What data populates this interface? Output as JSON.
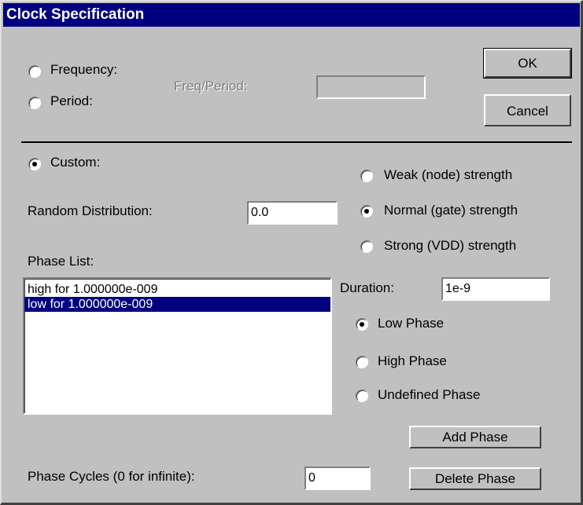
{
  "dialog": {
    "title": "Clock Specification"
  },
  "mode": {
    "frequency_label": "Frequency:",
    "period_label": "Period:",
    "custom_label": "Custom:",
    "selected": "Custom"
  },
  "freq_period": {
    "label": "Freq/Period:",
    "value": ""
  },
  "buttons": {
    "ok": "OK",
    "cancel": "Cancel",
    "add_phase": "Add Phase",
    "delete_phase": "Delete Phase"
  },
  "random_distribution": {
    "label": "Random Distribution:",
    "value": "0.0"
  },
  "strength": {
    "weak": "Weak (node) strength",
    "normal": "Normal (gate) strength",
    "strong": "Strong (VDD) strength",
    "selected": "Normal (gate) strength"
  },
  "phase_list": {
    "label": "Phase List:",
    "items": [
      "high for 1.000000e-009",
      "low for 1.000000e-009"
    ],
    "selected_index": 1
  },
  "duration": {
    "label": "Duration:",
    "value": "1e-9"
  },
  "phase_type": {
    "low": "Low Phase",
    "high": "High Phase",
    "undefined": "Undefined Phase",
    "selected": "Low Phase"
  },
  "phase_cycles": {
    "label": "Phase Cycles (0 for infinite):",
    "value": "0"
  },
  "colors": {
    "face": "#c0c0c0",
    "title_bar": "#000080",
    "selection": "#000080"
  }
}
